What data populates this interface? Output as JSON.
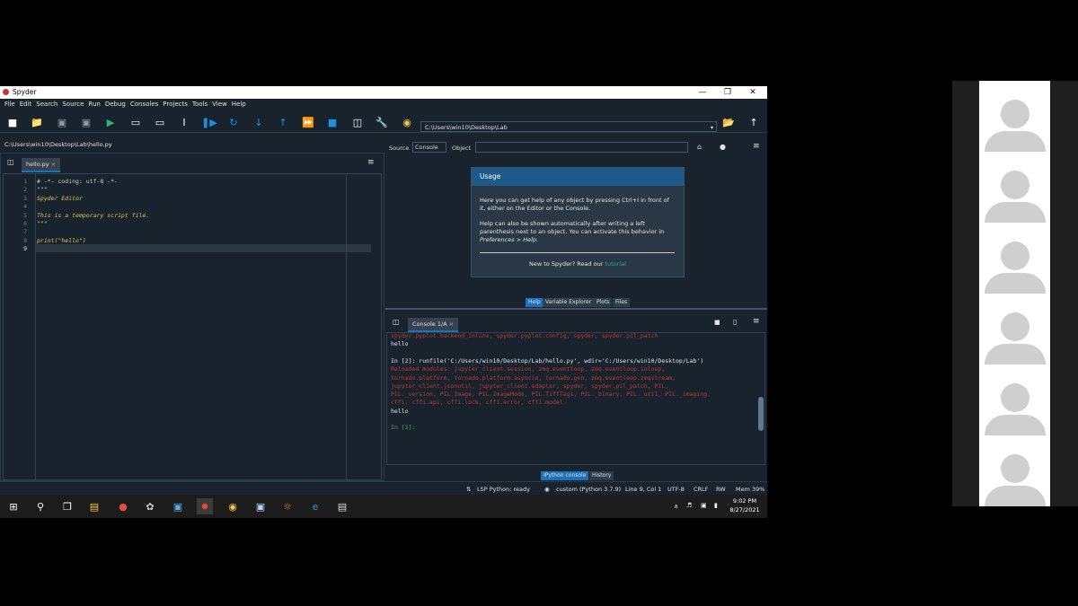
{
  "window": {
    "title": "Spyder",
    "controls": [
      "—",
      "❐",
      "✕"
    ]
  },
  "menu": [
    "File",
    "Edit",
    "Search",
    "Source",
    "Run",
    "Debug",
    "Consoles",
    "Projects",
    "Tools",
    "View",
    "Help"
  ],
  "toolbar": {
    "path": "C:\\Users\\win10\\Desktop\\Lab",
    "icons": [
      "new-file-icon",
      "open-file-icon",
      "save-icon",
      "save-all-icon",
      "run-icon",
      "run-cell-icon",
      "run-cell-advance-icon",
      "run-selection-icon",
      "debug-icon",
      "step-icon",
      "step-into-icon",
      "step-return-icon",
      "continue-icon",
      "stop-icon",
      "maximize-pane-icon",
      "wrench-icon",
      "python-icon"
    ]
  },
  "editor": {
    "path": "C:\\Users\\win10\\Desktop\\Lab\\hello.py",
    "tab": "hello.py",
    "tab_close": "×",
    "menu_icon": "≡",
    "lines": [
      {
        "n": "1",
        "text": "# -*- coding: utf-8 -*-",
        "color": "#c8c8c8"
      },
      {
        "n": "2",
        "text": "\"\"\"",
        "color": "#c8c8c8"
      },
      {
        "n": "3",
        "text": "Spyder Editor",
        "color": "#d6c95e"
      },
      {
        "n": "4",
        "text": "",
        "color": "#c8c8c8"
      },
      {
        "n": "5",
        "text": "This is a temporary script file.",
        "color": "#d6c95e"
      },
      {
        "n": "6",
        "text": "\"\"\"",
        "color": "#c8c8c8"
      },
      {
        "n": "7",
        "text": "",
        "color": "#c8c8c8"
      },
      {
        "n": "8",
        "text": "print(\"hello\")",
        "color": "#d6c95e"
      },
      {
        "n": "9",
        "text": "",
        "color": "#c8c8c8"
      }
    ]
  },
  "help": {
    "source_label": "Source",
    "source_value": "Console",
    "object_label": "Object",
    "usage_title": "Usage",
    "p1": "Here you can get help of any object by pressing Ctrl+I in front of it, either on the Editor or the Console.",
    "p2a": "Help can also be shown automatically after writing a left parenthesis next to an object. You can activate this behavior in ",
    "p2b": "Preferences > Help.",
    "p3a": "New to Spyder? Read our ",
    "p3b": "tutorial",
    "tabs": [
      "Help",
      "Variable Explorer",
      "Plots",
      "Files"
    ]
  },
  "console": {
    "tab": "Console 1/A",
    "tab_close": "×",
    "lines": [
      {
        "text": "spyder.pyplot.backend_inline, spyder.pyplot.config, spyder, spyder.pil_patch",
        "color": "#c0392b"
      },
      {
        "text": "hello",
        "color": "#e6e6e6"
      },
      {
        "text": "",
        "color": "#e6e6e6"
      },
      {
        "text": "In [2]: runfile('C:/Users/win10/Desktop/Lab/hello.py', wdir='C:/Users/win10/Desktop/Lab')",
        "color": "#e6e6e6"
      },
      {
        "text": "Reloaded modules: jupyter_client.session, zmq.eventloop, zmq.eventloop.ioloop,",
        "color": "#c0392b"
      },
      {
        "text": "tornado.platform, tornado.platform.asyncio, tornado.gen, zmq.eventloop.zmqstream,",
        "color": "#c0392b"
      },
      {
        "text": "jupyter_client.jsonutil, jupyter_client.adapter, spyder, spyder.pil_patch, PIL,",
        "color": "#c0392b"
      },
      {
        "text": "PIL._version, PIL.Image, PIL.ImageMode, PIL.TiffTags, PIL._binary, PIL._util, PIL._imaging,",
        "color": "#c0392b"
      },
      {
        "text": "cffi, cffi.api, cffi.lock, cffi.error, cffi.model",
        "color": "#c0392b"
      },
      {
        "text": "hello",
        "color": "#e6e6e6"
      },
      {
        "text": "",
        "color": "#e6e6e6"
      },
      {
        "text": "In [3]:",
        "color": "#3cb043"
      }
    ],
    "bottom_tabs": [
      "IPython console",
      "History"
    ]
  },
  "status": {
    "lsp": "LSP Python: ready",
    "env": "custom (Python 3.7.9)",
    "pos": "Line 9, Col 1",
    "enc": "UTF-8",
    "eol": "CRLF",
    "rw": "RW",
    "mem": "Mem 39%"
  },
  "taskbar": {
    "time": "9:02 PM",
    "date": "8/27/2021"
  },
  "colors": {
    "accent": "#1a72bb",
    "bg": "#19232d",
    "error": "#c0392b",
    "prompt": "#3cb043"
  }
}
